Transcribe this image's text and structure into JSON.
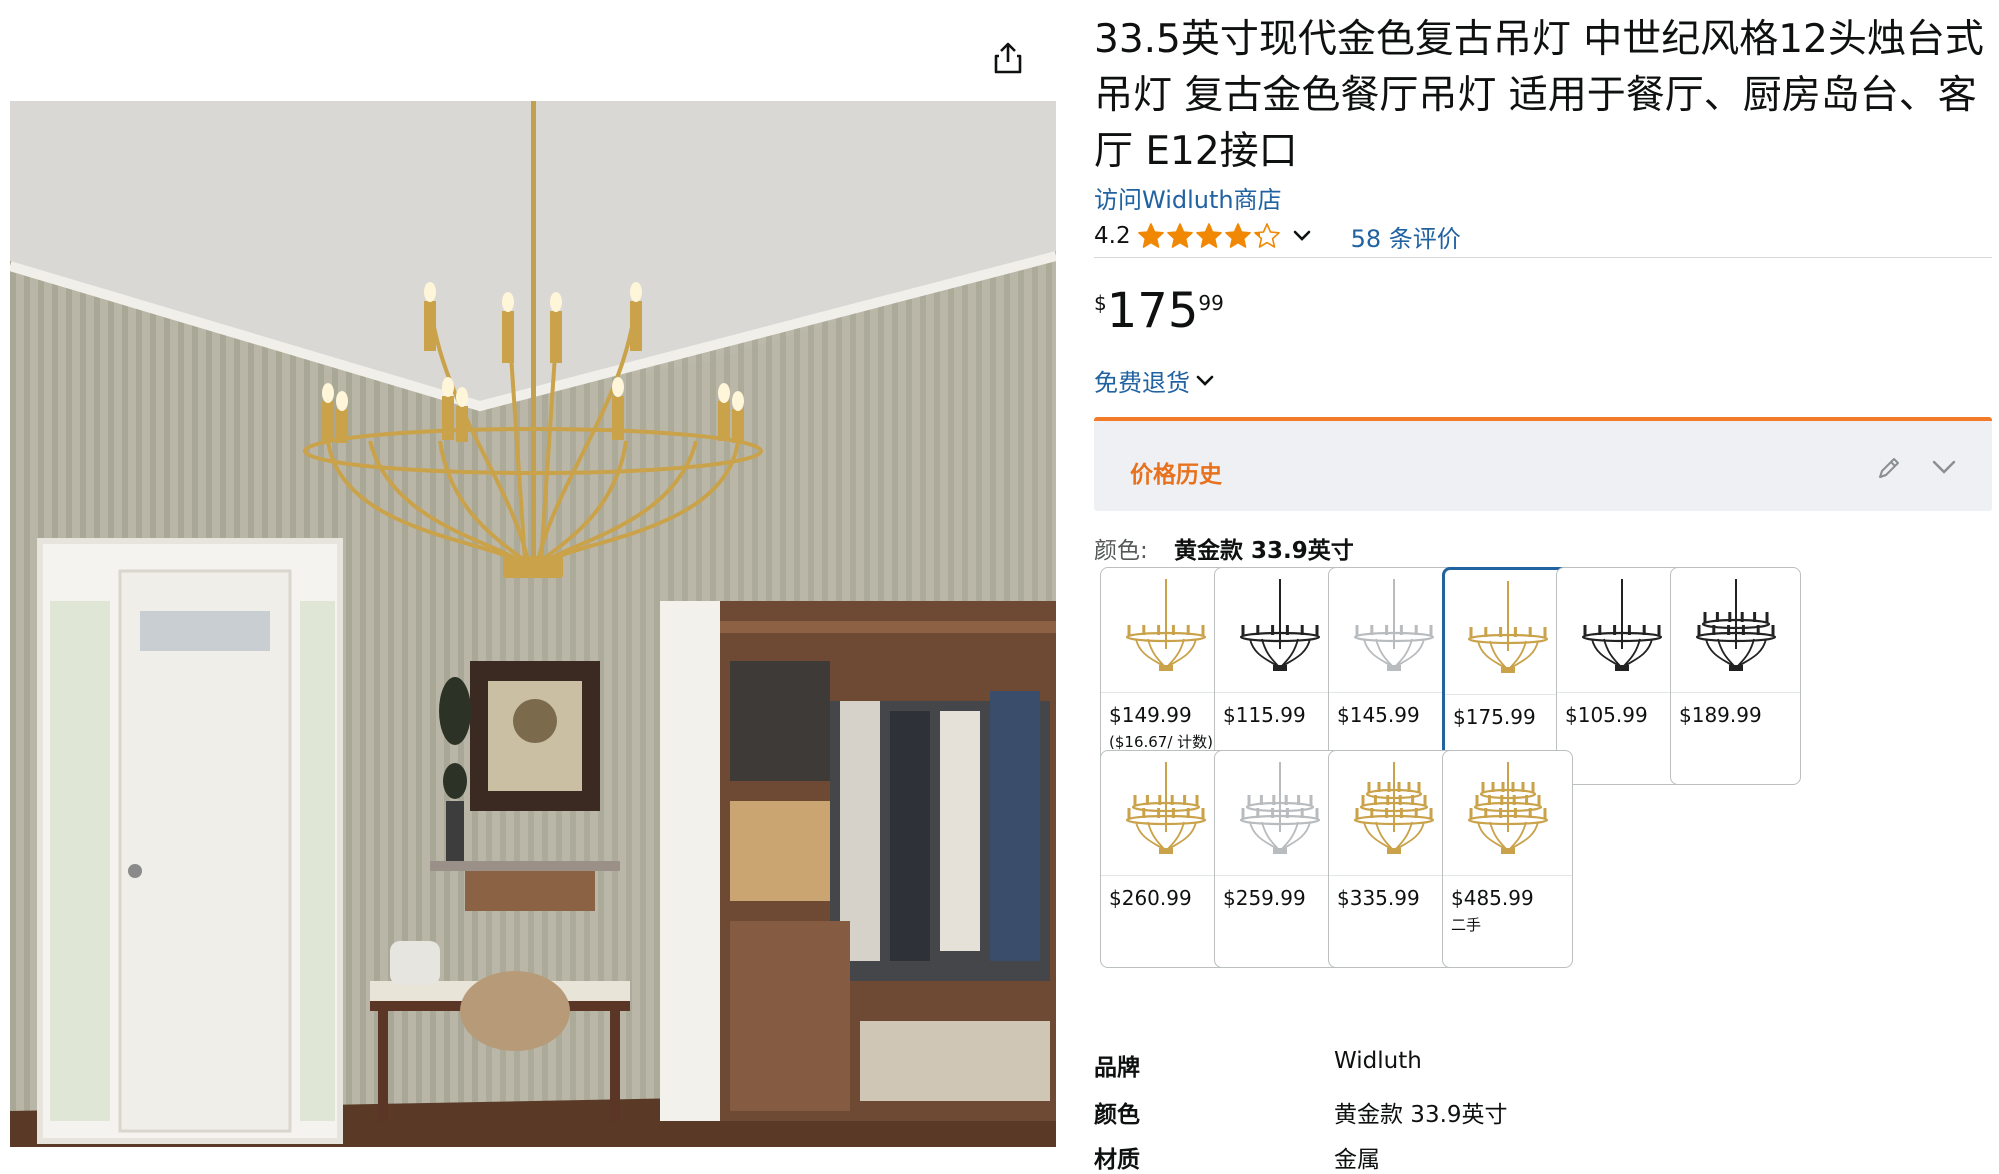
{
  "product": {
    "title": "33.5英寸现代金色复古吊灯 中世纪风格12头烛台式吊灯 复古金色餐厅吊灯 适用于餐厅、厨房岛台、客厅 E12接口",
    "store_link": "访问Widluth商店",
    "rating": "4.2",
    "rating_value": 4.2,
    "review_count": "58 条评价",
    "price_symbol": "$",
    "price_whole": "175",
    "price_fraction": "99",
    "returns_label": "免费退货"
  },
  "price_history": {
    "title": "价格历史"
  },
  "color": {
    "label": "颜色:",
    "selected": "黄金款 33.9英寸",
    "swatches": [
      {
        "price": "$149.99",
        "sub": "($16.67/ 计数)",
        "finish": "gold",
        "tiers": 1
      },
      {
        "price": "$115.99",
        "sub": "",
        "finish": "black",
        "tiers": 1
      },
      {
        "price": "$145.99",
        "sub": "",
        "finish": "silver",
        "tiers": 1
      },
      {
        "price": "$175.99",
        "sub": "",
        "finish": "gold",
        "tiers": 1
      },
      {
        "price": "$105.99",
        "sub": "",
        "finish": "black",
        "tiers": 1
      },
      {
        "price": "$189.99",
        "sub": "",
        "finish": "black",
        "tiers": 2
      },
      {
        "price": "$260.99",
        "sub": "",
        "finish": "gold",
        "tiers": 2
      },
      {
        "price": "$259.99",
        "sub": "",
        "finish": "silver",
        "tiers": 2
      },
      {
        "price": "$335.99",
        "sub": "",
        "finish": "gold",
        "tiers": 3
      },
      {
        "price": "$485.99",
        "sub": "二手",
        "finish": "gold",
        "tiers": 3
      }
    ],
    "selected_index": 3
  },
  "specs": [
    {
      "key": "品牌",
      "value": "Widluth"
    },
    {
      "key": "颜色",
      "value": "黄金款 33.9英寸"
    },
    {
      "key": "材质",
      "value": "金属"
    }
  ],
  "colors": {
    "link": "#2162a1",
    "star": "#f08804",
    "accent_orange": "#f27b2a",
    "selected_border": "#2162a1",
    "gold": "#c9a24a",
    "black": "#222222",
    "silver": "#b9bcbf"
  },
  "icons": {
    "share": "share-icon",
    "star": "star-icon",
    "chevron": "chevron-down-icon",
    "pencil": "pencil-icon"
  }
}
